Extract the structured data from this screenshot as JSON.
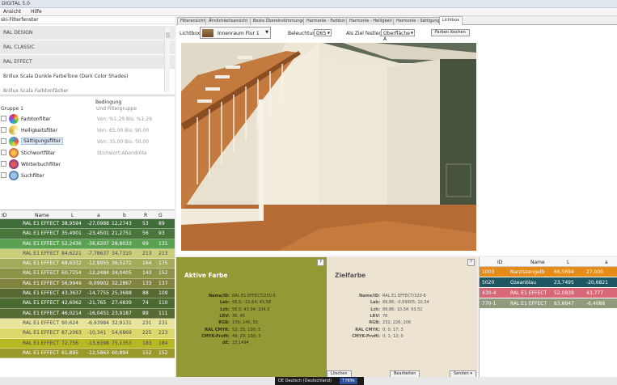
{
  "window": {
    "title": "DIGITAL 5.0"
  },
  "menu": {
    "items": [
      "Ansicht",
      "Hilfe"
    ]
  },
  "left_panel": {
    "header": "ski-Filterfenster",
    "categories": [
      "RAL DESIGN",
      "RAL CLASSIC",
      "RAL EFFECT"
    ],
    "category_lines": [
      "Brillux Scala Dunkle FarbeTone (Dark Color Shades)",
      "Brillux Scala Farbtonfächer"
    ]
  },
  "filters": {
    "condition_header": "Bedingung",
    "group_label": "Gruppe 1",
    "group_sub": "Und Filtergruppe",
    "items": [
      {
        "label": "Farbtonfilter",
        "condition": "Von: %1.29 Bis: %1.29",
        "color": "#d24b4b",
        "selected": false
      },
      {
        "label": "Helligkeitsfilter",
        "condition": "Von: 65.00 Bis: 90.00",
        "color": "#c9a83a",
        "selected": false
      },
      {
        "label": "Sättigungsfilter",
        "condition": "Von: 35.00 Bis: 50.00",
        "color": "#4c8fd4",
        "selected": true
      },
      {
        "label": "Stichwortfilter",
        "condition": "Stichwort:Abendröte",
        "color": "#c25a3a",
        "selected": false
      },
      {
        "label": "Wörterbuchfilter",
        "condition": "",
        "color": "#7a3a8a",
        "selected": false
      },
      {
        "label": "Suchfilter",
        "condition": "",
        "color": "#3a6fa5",
        "selected": false
      }
    ]
  },
  "color_table": {
    "columns": [
      "ID",
      "Name",
      "L",
      "a",
      "b",
      "R",
      "G"
    ],
    "rows": [
      {
        "name": "RAL E1 EFFECT",
        "L": "38,9594",
        "a": "-27,0988",
        "b": "12,2743",
        "R": "53",
        "G": "89",
        "bg": "#3f6e3a"
      },
      {
        "name": "RAL E1 EFFECT",
        "L": "35,4901",
        "a": "-23,4501",
        "b": "21,2751",
        "R": "56",
        "G": "93",
        "bg": "#47753a"
      },
      {
        "name": "RAL E1 EFFECT",
        "L": "52,2436",
        "a": "-36,6207",
        "b": "28,8033",
        "R": "69",
        "G": "131",
        "bg": "#5aa152"
      },
      {
        "name": "RAL E1 EFFECT",
        "L": "84,6221",
        "a": "-7,78637",
        "b": "34,7310",
        "R": "213",
        "G": "213",
        "bg": "#cbcf7c"
      },
      {
        "name": "RAL E1 EFFECT",
        "L": "68,6332",
        "a": "-12,8955",
        "b": "36,5272",
        "R": "164",
        "G": "175",
        "bg": "#a3aa5a"
      },
      {
        "name": "RAL E1 EFFECT",
        "L": "60,7254",
        "a": "-12,2484",
        "b": "34,0405",
        "R": "143",
        "G": "152",
        "bg": "#8d9447"
      },
      {
        "name": "RAL E1 EFFECT",
        "L": "56,9949",
        "a": "-9,09902",
        "b": "32,2867",
        "R": "133",
        "G": "137",
        "bg": "#81843f"
      },
      {
        "name": "RAL E1 EFFECT",
        "L": "43,3637",
        "a": "-14,7755",
        "b": "25,3688",
        "R": "88",
        "G": "109",
        "bg": "#566a32"
      },
      {
        "name": "RAL E1 EFFECT",
        "L": "42,6062",
        "a": "-21,765",
        "b": "27,4839",
        "R": "74",
        "G": "110",
        "bg": "#4a6b30"
      },
      {
        "name": "RAL E1 EFFECT",
        "L": "46,0214",
        "a": "-16,0451",
        "b": "23,9187",
        "R": "89",
        "G": "111",
        "bg": "#576c35"
      },
      {
        "name": "RAL E1 EFFECT",
        "L": "90,624",
        "a": "-6,93984",
        "b": "32,9131",
        "R": "231",
        "G": "231",
        "bg": "#e7e59b"
      },
      {
        "name": "RAL E1 EFFECT",
        "L": "87,2063",
        "a": "-10,341",
        "b": "54,6869",
        "R": "225",
        "G": "223",
        "bg": "#ddd86c"
      },
      {
        "name": "RAL E1 EFFECT",
        "L": "72,756",
        "a": "-13,6398",
        "b": "75,1353",
        "R": "183",
        "G": "184",
        "bg": "#b7b822"
      },
      {
        "name": "RAL E1 EFFECT",
        "L": "61,895",
        "a": "-12,5863",
        "b": "60,894",
        "R": "152",
        "G": "152",
        "bg": "#9a9a2a"
      }
    ]
  },
  "tabs": [
    {
      "label": "Filteransicht",
      "active": false
    },
    {
      "label": "Ähnlichkeitsansicht",
      "active": false
    },
    {
      "label": "Beste Übereinstimmungen",
      "active": false
    },
    {
      "label": "Harmonie - Farbton",
      "active": false
    },
    {
      "label": "Harmonie - Helligkeit",
      "active": false
    },
    {
      "label": "Harmonie - Sättigung",
      "active": false
    },
    {
      "label": "Lichtbox",
      "active": true
    }
  ],
  "toolbar": {
    "lightbox_label": "Lichtbox:",
    "lightbox_value": "Innenraum Flur 1",
    "lighting_label": "Beleuchtung:",
    "lighting_value": "D65",
    "target_label": "Als Ziel festlegen:",
    "target_value": "Oberfläche A",
    "reset_button": "Farben löschen"
  },
  "active_color": {
    "title": "Aktive Farbe",
    "fields": [
      {
        "k": "Name/ID:",
        "v": "RAL E1 EFFECT/250-5"
      },
      {
        "k": "Lab:",
        "v": "56,5; -11,64; 45,58"
      },
      {
        "k": "Lch:",
        "v": "56,5; 43,94; 104,3"
      },
      {
        "k": "LRV:",
        "v": "36, 45"
      },
      {
        "k": "RGB:",
        "v": "139; 146; 55"
      },
      {
        "k": "RAL CMYK:",
        "v": "52; 35; 100; 5"
      },
      {
        "k": "CMYK-Profil:",
        "v": "49; 29; 100; 3"
      },
      {
        "k": "dE:",
        "v": "23,1494"
      }
    ],
    "button": "Löschen",
    "bg": "#939a35"
  },
  "target_color": {
    "title": "Zielfarbe",
    "fields": [
      {
        "k": "Name/ID:",
        "v": "RAL E1 EFFECT/320-6"
      },
      {
        "k": "Lab:",
        "v": "89,86; -0,69905; 10,34"
      },
      {
        "k": "Lch:",
        "v": "89,86; 10,34; 93,52"
      },
      {
        "k": "LRV:",
        "v": "76"
      },
      {
        "k": "RGB:",
        "v": "232; 226; 206"
      },
      {
        "k": "RAL CMYK:",
        "v": "0; 0; 17; 3"
      },
      {
        "k": "CMYK-Profil:",
        "v": "0; 1; 12; 0"
      }
    ],
    "edit_button": "Bearbeiten",
    "send_button": "Senden",
    "bg": "#ece3d1"
  },
  "result_table": {
    "columns": [
      "ID",
      "Name",
      "L",
      "a"
    ],
    "rows": [
      {
        "id": "1003",
        "name": "Narzissengelb",
        "L": "66,5694",
        "a": "27,000",
        "bg": "#e48b18"
      },
      {
        "id": "5020",
        "name": "Ozeanblau",
        "L": "23,7495",
        "a": "-20,6821",
        "bg": "#1d5762"
      },
      {
        "id": "430-4",
        "name": "RAL E1 EFFECT",
        "L": "52,0839",
        "a": "43,777",
        "bg": "#d86777"
      },
      {
        "id": "770-1",
        "name": "RAL E1 EFFECT",
        "L": "63,8847",
        "a": "-6,4088",
        "bg": "#8f9b7c"
      }
    ]
  },
  "statusbar": {
    "language": "DE Deutsch (Deutschland)",
    "help": "Hilfe"
  }
}
